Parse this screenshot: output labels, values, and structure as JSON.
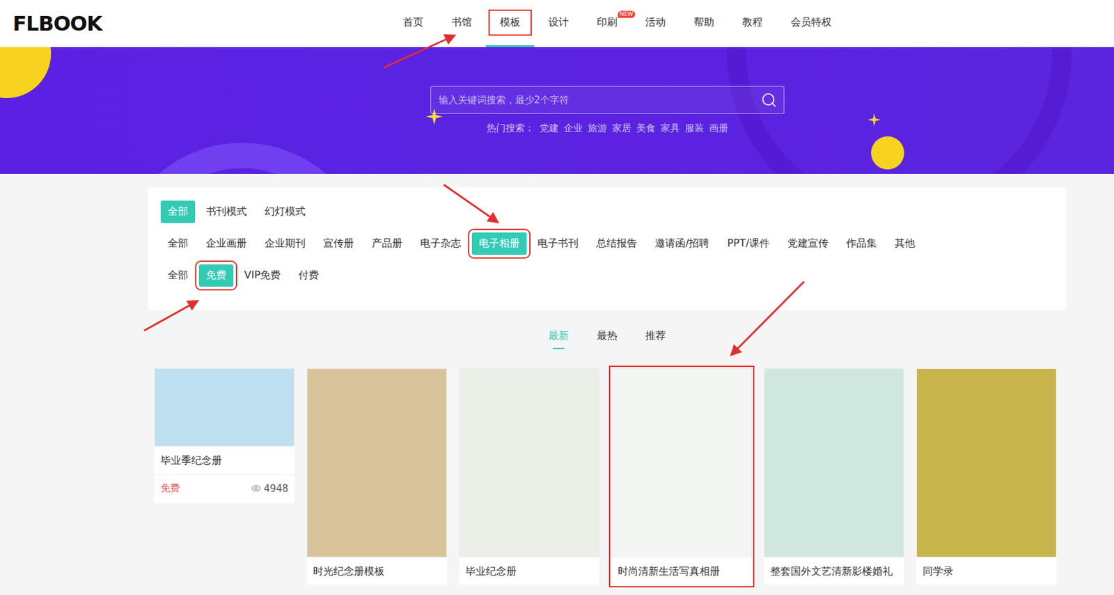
{
  "logo": "FLBOOK",
  "nav": [
    {
      "label": "首页",
      "selected": false,
      "highlighted": false,
      "badge": ""
    },
    {
      "label": "书馆",
      "selected": false,
      "highlighted": false,
      "badge": ""
    },
    {
      "label": "模板",
      "selected": true,
      "highlighted": true,
      "badge": ""
    },
    {
      "label": "设计",
      "selected": false,
      "highlighted": false,
      "badge": ""
    },
    {
      "label": "印刷",
      "selected": false,
      "highlighted": false,
      "badge": "NEW"
    },
    {
      "label": "活动",
      "selected": false,
      "highlighted": false,
      "badge": ""
    },
    {
      "label": "帮助",
      "selected": false,
      "highlighted": false,
      "badge": ""
    },
    {
      "label": "教程",
      "selected": false,
      "highlighted": false,
      "badge": ""
    },
    {
      "label": "会员特权",
      "selected": false,
      "highlighted": false,
      "badge": ""
    }
  ],
  "search": {
    "placeholder": "输入关键词搜索，最少2个字符",
    "hot_label": "热门搜索：",
    "hot": [
      "党建",
      "企业",
      "旅游",
      "家居",
      "美食",
      "家具",
      "服装",
      "画册"
    ]
  },
  "filters": [
    {
      "name": "mode",
      "options": [
        {
          "label": "全部",
          "selected": true,
          "highlighted": false
        },
        {
          "label": "书刊模式",
          "selected": false,
          "highlighted": false
        },
        {
          "label": "幻灯模式",
          "selected": false,
          "highlighted": false
        }
      ]
    },
    {
      "name": "category",
      "options": [
        {
          "label": "全部",
          "selected": false,
          "highlighted": false
        },
        {
          "label": "企业画册",
          "selected": false,
          "highlighted": false
        },
        {
          "label": "企业期刊",
          "selected": false,
          "highlighted": false
        },
        {
          "label": "宣传册",
          "selected": false,
          "highlighted": false
        },
        {
          "label": "产品册",
          "selected": false,
          "highlighted": false
        },
        {
          "label": "电子杂志",
          "selected": false,
          "highlighted": false
        },
        {
          "label": "电子相册",
          "selected": true,
          "highlighted": true
        },
        {
          "label": "电子书刊",
          "selected": false,
          "highlighted": false
        },
        {
          "label": "总结报告",
          "selected": false,
          "highlighted": false
        },
        {
          "label": "邀请函/招聘",
          "selected": false,
          "highlighted": false
        },
        {
          "label": "PPT/课件",
          "selected": false,
          "highlighted": false
        },
        {
          "label": "党建宣传",
          "selected": false,
          "highlighted": false
        },
        {
          "label": "作品集",
          "selected": false,
          "highlighted": false
        },
        {
          "label": "其他",
          "selected": false,
          "highlighted": false
        }
      ]
    },
    {
      "name": "price",
      "options": [
        {
          "label": "全部",
          "selected": false,
          "highlighted": false
        },
        {
          "label": "免费",
          "selected": true,
          "highlighted": true
        },
        {
          "label": "VIP免费",
          "selected": false,
          "highlighted": false
        },
        {
          "label": "付费",
          "selected": false,
          "highlighted": false
        }
      ]
    }
  ],
  "sort_tabs": [
    {
      "label": "最新",
      "selected": true
    },
    {
      "label": "最热",
      "selected": false
    },
    {
      "label": "推荐",
      "selected": false
    }
  ],
  "cards": [
    {
      "title": "毕业季纪念册",
      "kind": "info",
      "price": "免费",
      "views": "4948",
      "highlighted": false,
      "color": "#bfe0ef"
    },
    {
      "title": "时光纪念册模板",
      "kind": "cover",
      "price": "",
      "views": "",
      "highlighted": false,
      "color": "#d8c49a"
    },
    {
      "title": "毕业纪念册",
      "kind": "cover",
      "price": "",
      "views": "",
      "highlighted": false,
      "color": "#eceee8"
    },
    {
      "title": "时尚清新生活写真相册",
      "kind": "cover",
      "price": "",
      "views": "",
      "highlighted": true,
      "color": "#f4f6f3"
    },
    {
      "title": "整套国外文艺清新影楼婚礼",
      "kind": "cover",
      "price": "",
      "views": "",
      "highlighted": false,
      "color": "#cfe7df"
    },
    {
      "title": "同学录",
      "kind": "cover",
      "price": "",
      "views": "",
      "highlighted": false,
      "color": "#c7b54c"
    }
  ]
}
